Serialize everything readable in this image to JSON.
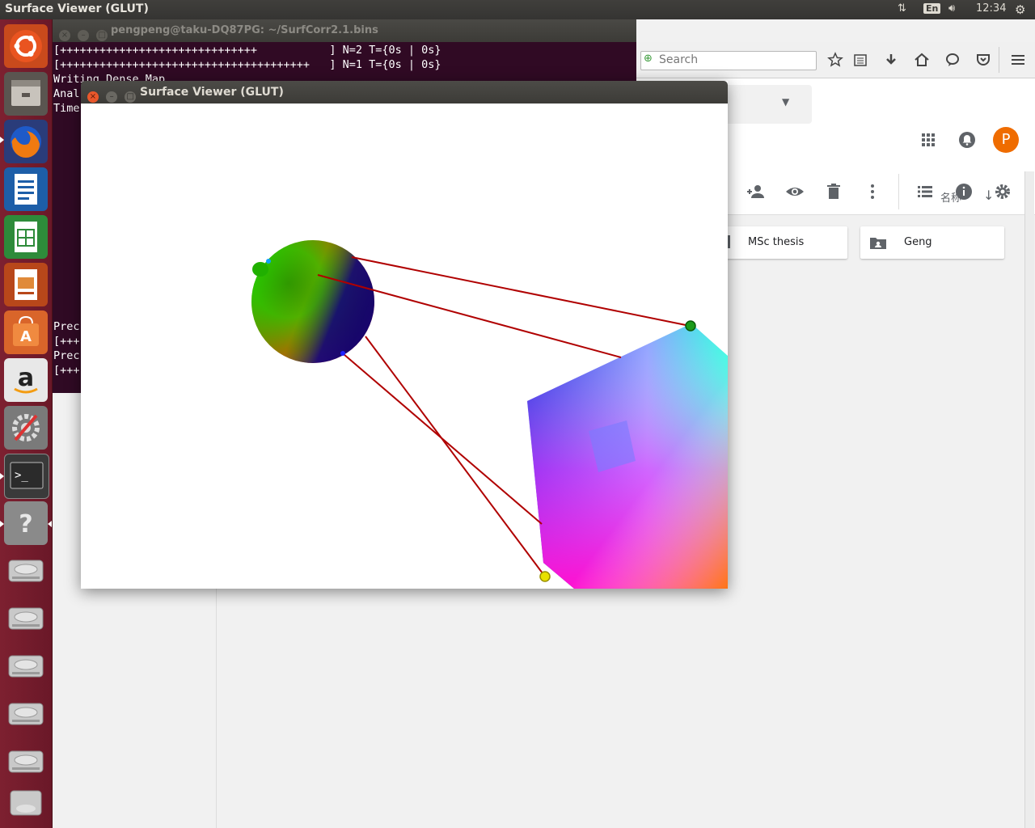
{
  "top_panel": {
    "title": "Surface Viewer (GLUT)",
    "language": "En",
    "time": "12:34"
  },
  "launcher": {
    "items": [
      "ubuntu-dash-icon",
      "files-icon",
      "firefox-icon",
      "writer-icon",
      "calc-icon",
      "impress-icon",
      "software-center-icon",
      "amazon-icon",
      "system-settings-icon",
      "terminal-icon",
      "help-icon",
      "drive-icon",
      "drive-icon",
      "drive-icon",
      "drive-icon",
      "drive-icon",
      "trash-icon"
    ]
  },
  "terminal": {
    "title": "pengpeng@taku-DQ87PG: ~/SurfCorr2.1.bins",
    "lines": [
      "[++++++++++++++++++++++++++++++           ] N=2 T={0s | 0s}",
      "[++++++++++++++++++++++++++++++++++++++   ] N=1 T={0s | 0s}",
      "Writing Dense Map",
      "Anal",
      "Time"
    ],
    "lower_lines": [
      "Prec",
      "[+++",
      "Prec",
      "[+++"
    ]
  },
  "browser": {
    "search_placeholder": "Search",
    "avatar_letter": "P",
    "sort_label": "名称",
    "folders": [
      "MSc thesis",
      "Geng"
    ]
  },
  "glut": {
    "title": "Surface Viewer (GLUT)"
  },
  "colors": {
    "launcher_bg": "#7d2030",
    "terminal_bg": "#300a24",
    "accent_orange": "#ef6c00",
    "correspondence_line": "#b00000"
  }
}
